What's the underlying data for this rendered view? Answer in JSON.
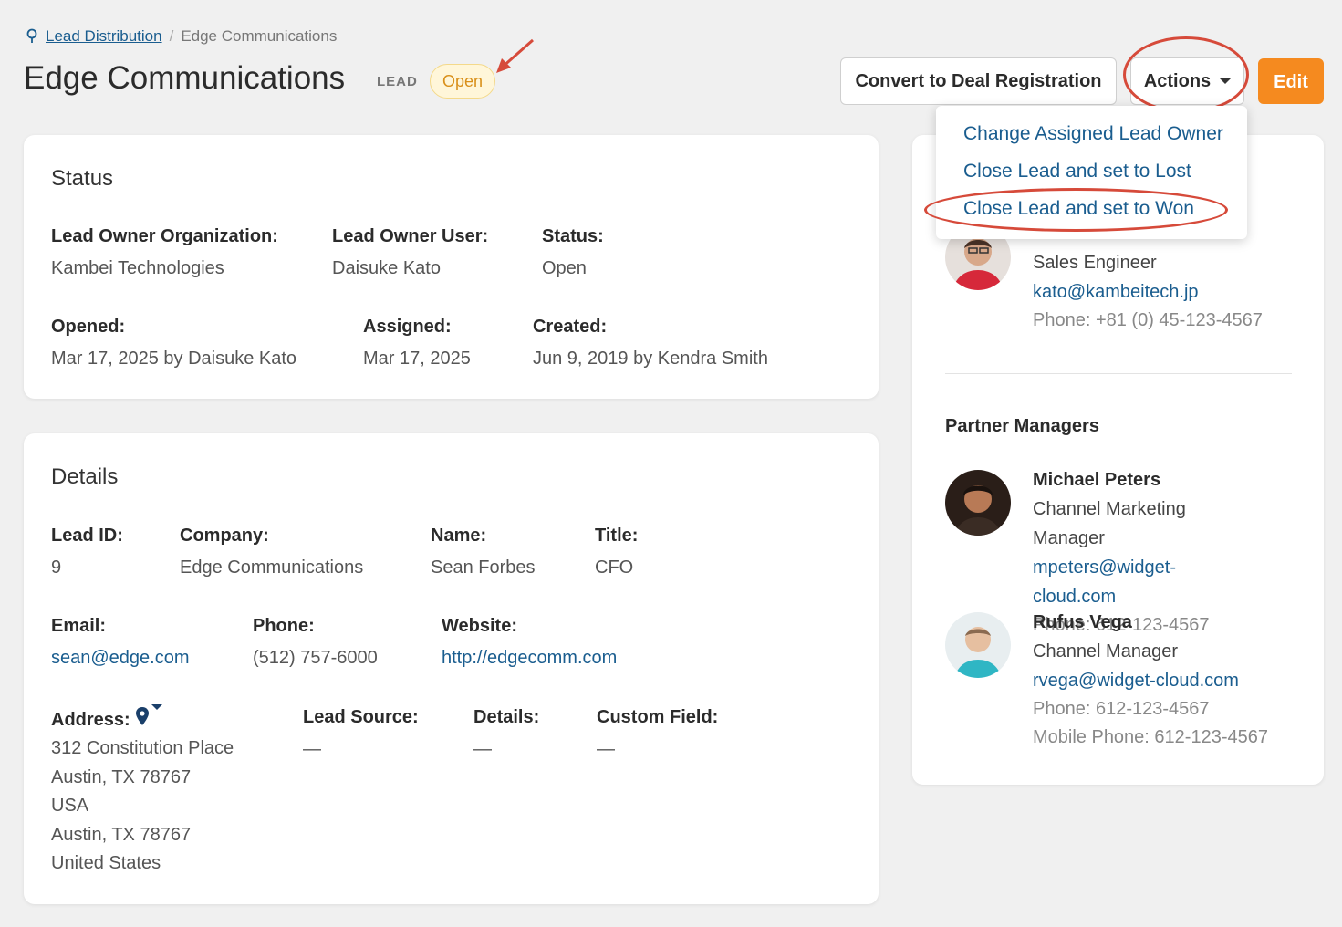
{
  "breadcrumb": {
    "parent": "Lead Distribution",
    "current": "Edge Communications"
  },
  "header": {
    "title": "Edge Communications",
    "type_label": "LEAD",
    "status_badge": "Open",
    "convert_button": "Convert to Deal Registration",
    "actions_button": "Actions",
    "edit_button": "Edit"
  },
  "actions_menu": [
    "Change Assigned Lead Owner",
    "Close Lead and set to Lost",
    "Close Lead and set to Won"
  ],
  "status_card": {
    "title": "Status",
    "fields": {
      "lead_owner_org": {
        "label": "Lead Owner Organization:",
        "value": "Kambei Technologies"
      },
      "lead_owner_user": {
        "label": "Lead Owner User:",
        "value": "Daisuke Kato"
      },
      "status": {
        "label": "Status:",
        "value": "Open"
      },
      "opened": {
        "label": "Opened:",
        "value": "Mar 17, 2025 by Daisuke Kato"
      },
      "assigned": {
        "label": "Assigned:",
        "value": "Mar 17, 2025"
      },
      "created": {
        "label": "Created:",
        "value": "Jun 9, 2019 by Kendra Smith"
      }
    }
  },
  "details_card": {
    "title": "Details",
    "fields": {
      "lead_id": {
        "label": "Lead ID:",
        "value": "9"
      },
      "company": {
        "label": "Company:",
        "value": "Edge Communications"
      },
      "name": {
        "label": "Name:",
        "value": "Sean Forbes"
      },
      "title": {
        "label": "Title:",
        "value": "CFO"
      },
      "email": {
        "label": "Email:",
        "value": "sean@edge.com"
      },
      "phone": {
        "label": "Phone:",
        "value": "(512) 757-6000"
      },
      "website": {
        "label": "Website:",
        "value": "http://edgecomm.com"
      },
      "address": {
        "label": "Address:",
        "lines": [
          "312 Constitution Place",
          "Austin, TX 78767",
          "USA",
          "Austin, TX 78767",
          "United States"
        ]
      },
      "lead_source": {
        "label": "Lead Source:",
        "value": "—"
      },
      "details": {
        "label": "Details:",
        "value": "—"
      },
      "custom_field": {
        "label": "Custom Field:",
        "value": "—"
      }
    }
  },
  "lead_owner_contact": {
    "role": "Sales Engineer",
    "email": "kato@kambeitech.jp",
    "phone": "Phone: +81 (0) 45-123-4567"
  },
  "partner_managers": {
    "title": "Partner Managers",
    "people": [
      {
        "name": "Michael Peters",
        "role": "Channel Marketing Manager",
        "email": "mpeters@widget-cloud.com",
        "phone": "Phone: 612-123-4567"
      },
      {
        "name": "Rufus Vega",
        "role": "Channel Manager",
        "email": "rvega@widget-cloud.com",
        "phone": "Phone: 612-123-4567",
        "mobile": "Mobile Phone: 612-123-4567"
      }
    ]
  },
  "colors": {
    "accent": "#f58a1f",
    "link": "#1a5d8f",
    "badge_text": "#d9901a",
    "annotation": "#d64a3a"
  }
}
